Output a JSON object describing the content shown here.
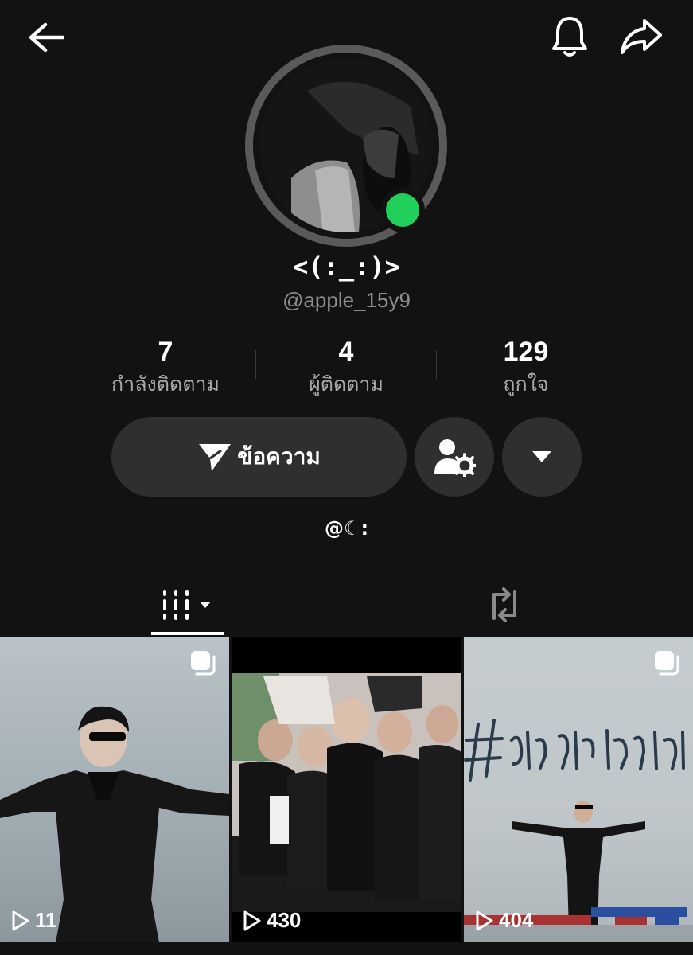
{
  "header": {
    "back_icon": "arrow-left-icon",
    "bell_icon": "bell-icon",
    "share_icon": "share-arrow-icon"
  },
  "profile": {
    "display_name": "<(:_:)>",
    "username": "@apple_15y9",
    "online_status_color": "#20d05a",
    "bio": "@☾:"
  },
  "stats": [
    {
      "value": "7",
      "label": "กำลังติดตาม"
    },
    {
      "value": "4",
      "label": "ผู้ติดตาม"
    },
    {
      "value": "129",
      "label": "ถูกใจ"
    }
  ],
  "actions": {
    "message_label": "ข้อความ",
    "message_icon": "paper-plane-icon",
    "settings_icon": "user-gear-icon",
    "dropdown_icon": "caret-down-icon"
  },
  "tabs": {
    "videos_icon": "video-grid-icon",
    "reposts_icon": "repost-icon"
  },
  "videos": [
    {
      "views": "11",
      "multi": true
    },
    {
      "views": "430",
      "multi": false
    },
    {
      "views": "404",
      "multi": true
    }
  ],
  "colors": {
    "background": "#121212",
    "button_bg": "#2f2f2f",
    "muted_text": "#a9a9a9"
  }
}
